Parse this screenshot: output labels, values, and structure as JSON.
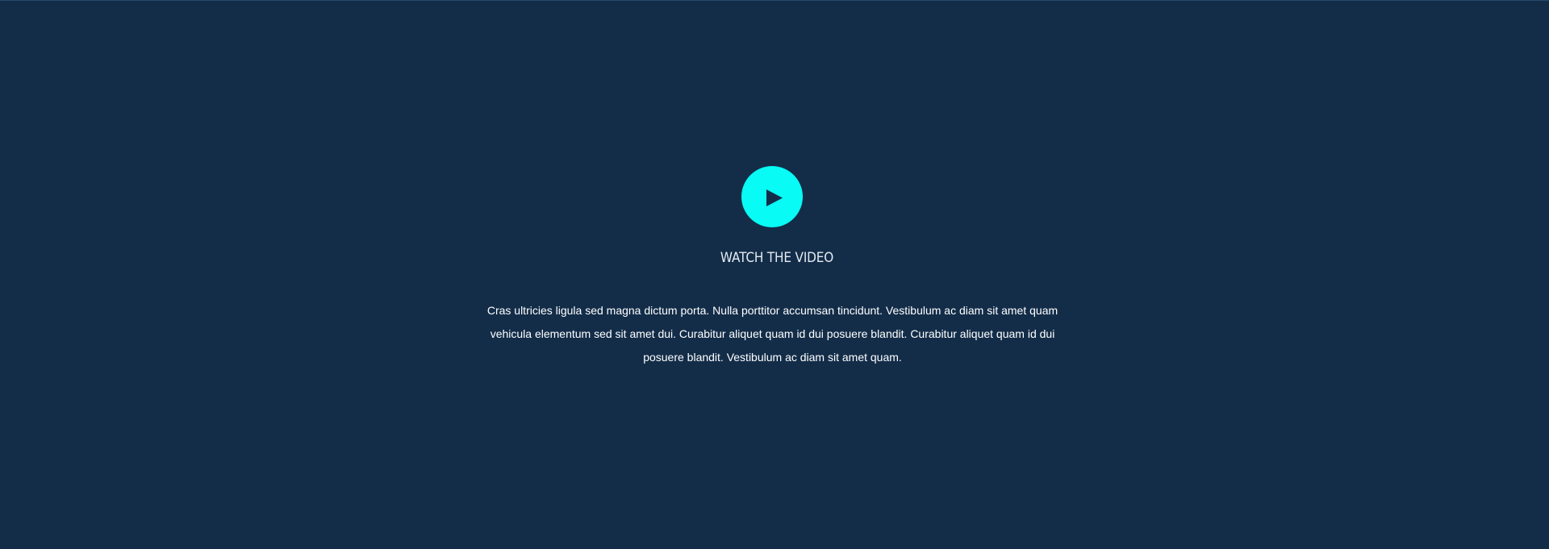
{
  "video_section": {
    "play_button": {
      "icon": "play-icon",
      "color": "#08fbf4",
      "icon_color": "#132d49"
    },
    "title": "WATCH THE VIDEO",
    "description": "Cras ultricies ligula sed magna dictum porta. Nulla porttitor accumsan tincidunt. Vestibulum ac diam sit amet quam vehicula elementum sed sit amet dui. Curabitur aliquet quam id dui posuere blandit. Curabitur aliquet quam id dui posuere blandit. Vestibulum ac diam sit amet quam.",
    "background_color": "#132d49",
    "text_color": "#ffffff"
  }
}
